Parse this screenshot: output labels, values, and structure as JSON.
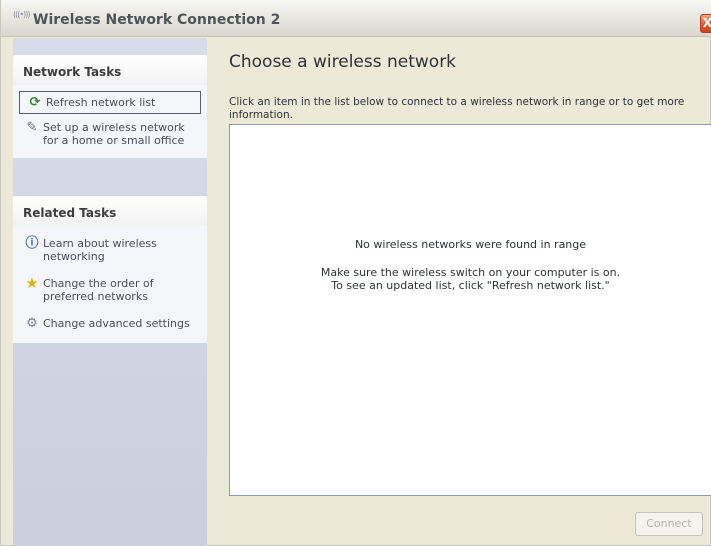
{
  "window": {
    "title": "Wireless Network Connection 2",
    "title_icon": "wireless-signal-icon",
    "close_label": "X"
  },
  "sidebar": {
    "network_tasks": {
      "header": "Network Tasks",
      "items": [
        {
          "label": "Refresh network list",
          "icon": "refresh-icon",
          "selected": true
        },
        {
          "label": "Set up a wireless network for a home or small office",
          "icon": "setup-wireless-icon"
        }
      ]
    },
    "related_tasks": {
      "header": "Related Tasks",
      "items": [
        {
          "label": "Learn about wireless networking",
          "icon": "info-icon"
        },
        {
          "label": "Change the order of preferred networks",
          "icon": "star-icon"
        },
        {
          "label": "Change advanced settings",
          "icon": "settings-icon"
        }
      ]
    }
  },
  "main": {
    "title": "Choose a wireless network",
    "instructions": "Click an item in the list below to connect to a wireless network in range or to get more information.",
    "empty_title": "No wireless networks were found in range",
    "empty_line1": "Make sure the wireless switch on your computer is on.",
    "empty_line2": "To see an updated list, click \"Refresh network list.\"",
    "connect_label": "Connect",
    "connect_enabled": false
  }
}
